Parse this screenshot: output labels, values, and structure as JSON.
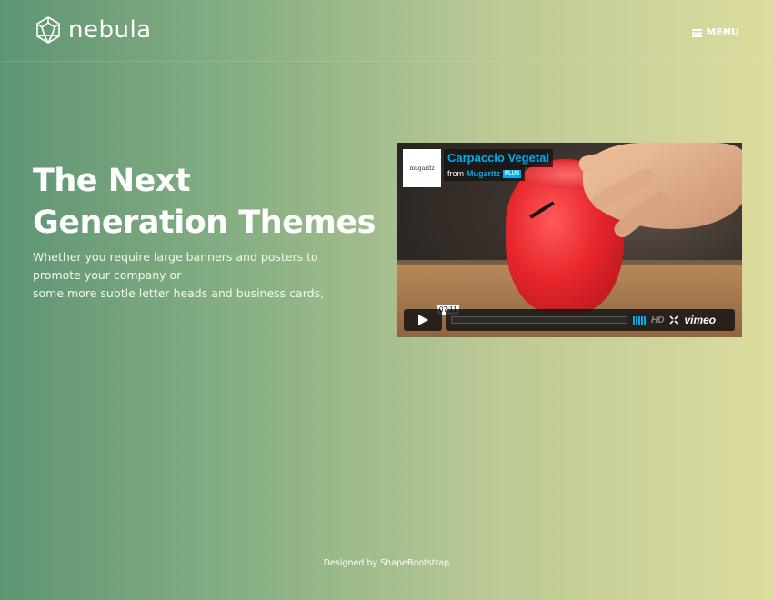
{
  "header": {
    "brand": "nebula",
    "logo_icon": "geodesic-sphere-icon",
    "menu_icon": "hamburger-icon",
    "menu_label": "MENU"
  },
  "hero": {
    "title_line1": "The Next",
    "title_line2": "Generation Themes",
    "text_line1": "Whether you require large banners and posters to promote your company or",
    "text_line2": "some more subtle letter heads and business cards,"
  },
  "video": {
    "title": "Carpaccio Vegetal",
    "from_label": "from",
    "owner": "Mugaritz",
    "badge": "PLUS",
    "thumb_text": "mugaritz",
    "time": "07:11",
    "hd_label": "HD",
    "brand": "vimeo",
    "progress": 0,
    "accent": "#00adef"
  },
  "footer": {
    "credit": "Designed by ShapeBootstrap"
  },
  "colors": {
    "gradient_left": "#5e9574",
    "gradient_right": "#dddc9e",
    "text": "#ffffff"
  }
}
